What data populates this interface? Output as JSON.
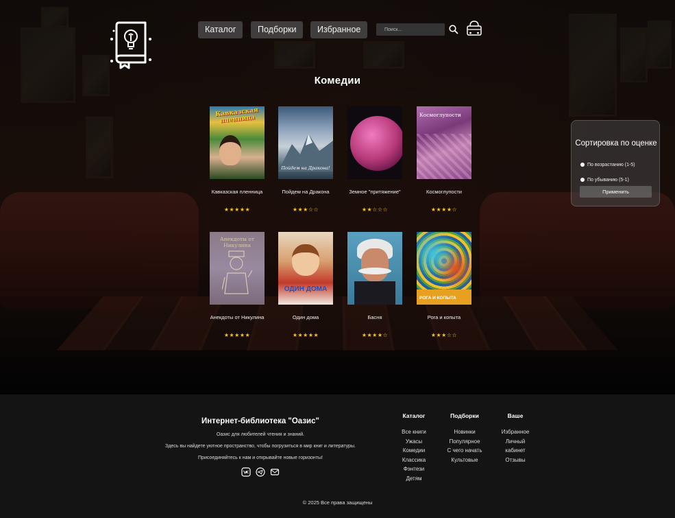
{
  "header": {
    "nav": [
      {
        "label": "Каталог"
      },
      {
        "label": "Подборки"
      },
      {
        "label": "Избранное"
      }
    ],
    "search_placeholder": "Поиск...",
    "icons": {
      "logo": "book-lightbulb-logo",
      "search": "search-icon",
      "cart": "basket-icon"
    }
  },
  "page_title": "Комедии",
  "books": [
    {
      "title": "Кавказская пленница",
      "rating": 5,
      "stars": "★★★★★",
      "cover_text": "Кавказская пленница",
      "cover_color": "#5a8a3a"
    },
    {
      "title": "Пойдем на Дракона",
      "rating": 3,
      "stars": "★★★☆☆",
      "cover_text": "Пойдем на Дракона!",
      "cover_color": "#6f8aa0"
    },
    {
      "title": "Земное \"притяжение\"",
      "rating": 2,
      "stars": "★★☆☆☆",
      "cover_text": "",
      "cover_color": "#b83a7a"
    },
    {
      "title": "Космоглупости",
      "rating": 4,
      "stars": "★★★★☆",
      "cover_text": "Космоглупости",
      "cover_color": "#9a4a8a"
    },
    {
      "title": "Анекдоты от Никулина",
      "rating": 5,
      "stars": "★★★★★",
      "cover_text": "Анекдоты от Никулина",
      "cover_color": "#8a7a8a"
    },
    {
      "title": "Один дома",
      "rating": 5,
      "stars": "★★★★★",
      "cover_text": "ОДИН ДОМА",
      "cover_color": "#c23a2a"
    },
    {
      "title": "Басня",
      "rating": 4,
      "stars": "★★★★☆",
      "cover_text": "",
      "cover_color": "#4a8aa0"
    },
    {
      "title": "Рога и копыта",
      "rating": 3,
      "stars": "★★★☆☆",
      "cover_text": "РОГА И КОПЫТА",
      "cover_color": "#e0a020"
    }
  ],
  "sort_panel": {
    "title": "Сортировка по оценке",
    "options": [
      "По возрастанию (1-5)",
      "По убыванию (5-1)"
    ],
    "apply_label": "Применить"
  },
  "footer": {
    "title": "Интернет-библиотека \"Оазис\"",
    "lines": [
      "Оазис для любителей чтения и знаний.",
      "Здесь вы найдете уютное пространство, чтобы погрузиться в мир книг и литературы.",
      "Присоединяйтесь к нам и открывайте новые горизонты!"
    ],
    "social_icons": [
      "vk-icon",
      "telegram-icon",
      "mail-icon"
    ],
    "columns": [
      {
        "head": "Каталог",
        "links": [
          "Все книги",
          "Ужасы",
          "Комедии",
          "Классика",
          "Фэнтези",
          "Детям"
        ]
      },
      {
        "head": "Подборки",
        "links": [
          "Новинки",
          "Популярное",
          "С чего начать",
          "Культовые"
        ]
      },
      {
        "head": "Ваше",
        "links": [
          "Избранное",
          "Личный кабинет",
          "Отзывы"
        ]
      }
    ],
    "copyright": "© 2025 Все права защищены"
  },
  "colors": {
    "star": "#f3c623",
    "panel": "#464646",
    "footer_bg": "#141414"
  }
}
